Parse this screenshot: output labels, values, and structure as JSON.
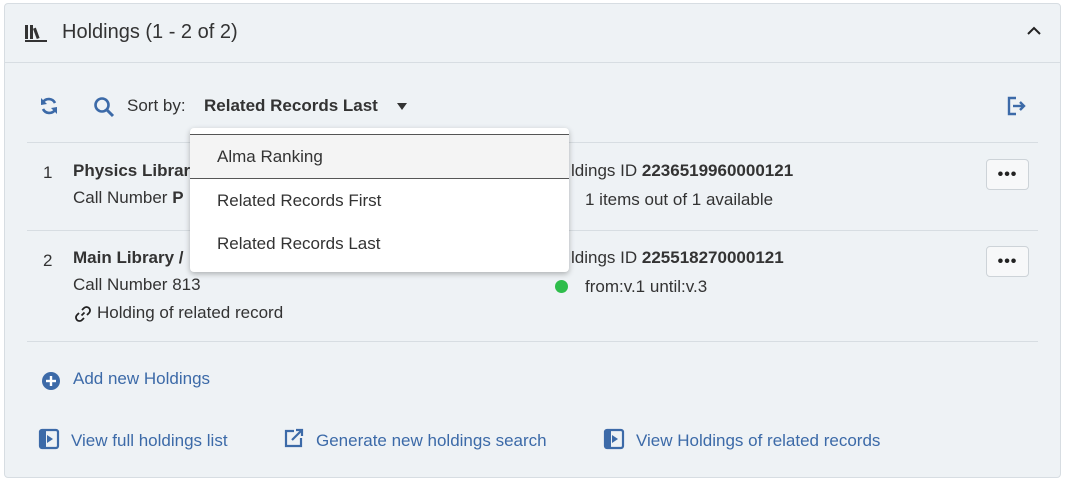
{
  "header": {
    "title": "Holdings (1 - 2 of 2)"
  },
  "toolbar": {
    "sort_label": "Sort by:",
    "sort_value": "Related Records Last"
  },
  "rows": [
    {
      "num": "1",
      "library": "Physics Librar",
      "call_prefix": "Call Number",
      "call_value": "P",
      "holdings_id_label": "ldings ID",
      "holdings_id": "2236519960000121",
      "availability": "1 items out of 1 available",
      "more": "•••"
    },
    {
      "num": "2",
      "library": "Main Library /",
      "call_prefix": "Call Number",
      "call_value": "813",
      "holdings_id_label": "ldings ID",
      "holdings_id": "225518270000121",
      "availability": "from:v.1 until:v.3",
      "related": "Holding of related record",
      "more": "•••"
    }
  ],
  "sort_menu": {
    "options": [
      "Alma Ranking",
      "Related Records First",
      "Related Records Last"
    ],
    "highlighted": "Alma Ranking"
  },
  "actions": {
    "add_new": "Add new Holdings",
    "view_full": "View full holdings list",
    "generate_search": "Generate new holdings search",
    "view_related": "View Holdings of related records"
  },
  "colors": {
    "link": "#3c6aa8",
    "available": "#2ebd4b",
    "panel_bg": "#eef2f5"
  },
  "icons": [
    "books-icon",
    "chevron-up-icon",
    "refresh-icon",
    "search-icon",
    "export-icon",
    "link-icon",
    "plus-circle-icon",
    "enter-icon",
    "external-link-icon"
  ]
}
